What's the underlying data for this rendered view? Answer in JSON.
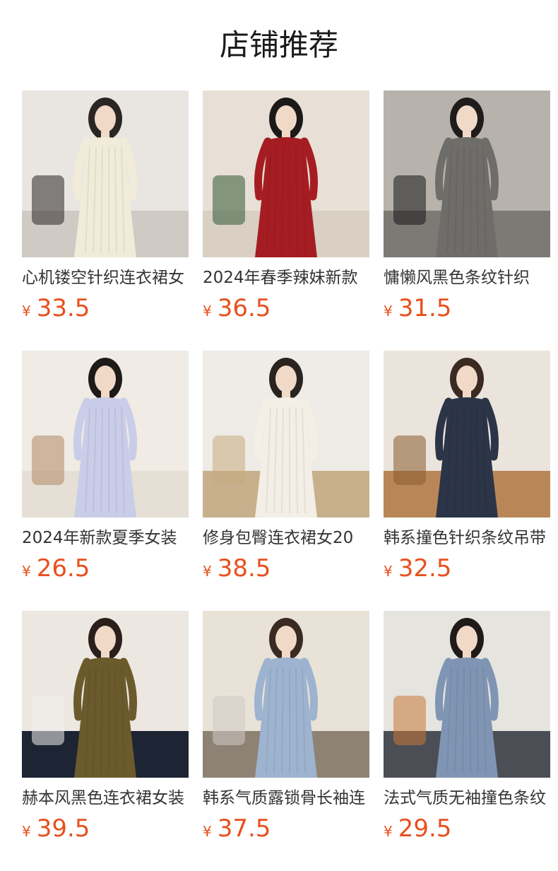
{
  "header": {
    "title": "店铺推荐"
  },
  "currency_symbol": "¥",
  "products": [
    {
      "title": "心机镂空针织连衣裙女",
      "price": "33.5",
      "image": "cream-ribbed-knit-cutout-dress-photo",
      "palette": {
        "bg": "#e9e6e1",
        "floor": "#cfcac3",
        "garment": "#f1ecd9",
        "hair": "#2a2623",
        "accent": "#2b2727"
      }
    },
    {
      "title": "2024年春季辣妹新款",
      "price": "36.5",
      "image": "red-knit-mini-dress-christmas-tree-photo",
      "palette": {
        "bg": "#e8e0d6",
        "floor": "#d9cfc3",
        "garment": "#a51d22",
        "hair": "#1c1919",
        "accent": "#2f5a34"
      }
    },
    {
      "title": "慵懒风黑色条纹针织",
      "price": "31.5",
      "image": "black-white-striped-slip-dress-street-photo",
      "palette": {
        "bg": "#b7b3ac",
        "floor": "#7d7a76",
        "garment": "#6f6d69",
        "hair": "#1f1c1b",
        "accent": "#151515"
      }
    },
    {
      "title": "2024年新款夏季女装",
      "price": "26.5",
      "image": "lavender-sleeveless-knit-dress-photo",
      "palette": {
        "bg": "#f0ebe4",
        "floor": "#e5dfd6",
        "garment": "#c9cde8",
        "hair": "#1e1a18",
        "accent": "#b08964"
      }
    },
    {
      "title": "修身包臀连衣裙女20",
      "price": "38.5",
      "image": "white-long-sleeve-knit-bodycon-dress-photo",
      "palette": {
        "bg": "#efebe6",
        "floor": "#c8b08c",
        "garment": "#f3eee6",
        "hair": "#2a2420",
        "accent": "#c7ab7f"
      }
    },
    {
      "title": "韩系撞色针织条纹吊带",
      "price": "32.5",
      "image": "navy-striped-knit-slip-dress-photo",
      "palette": {
        "bg": "#eae4dc",
        "floor": "#b98757",
        "garment": "#2c3447",
        "hair": "#3a2a22",
        "accent": "#8b5a2f"
      }
    },
    {
      "title": "赫本风黑色连衣裙女装",
      "price": "39.5",
      "image": "olive-cutout-knit-dress-mirror-photo",
      "palette": {
        "bg": "#ece7e0",
        "floor": "#1d2433",
        "garment": "#6b5a2c",
        "hair": "#2a1f1a",
        "accent": "#f3f1ee"
      }
    },
    {
      "title": "韩系气质露锁骨长袖连",
      "price": "37.5",
      "image": "blue-long-sleeve-knit-mini-dress-sofa-photo",
      "palette": {
        "bg": "#e9e2d7",
        "floor": "#8e8274",
        "garment": "#9db3cf",
        "hair": "#3a2b22",
        "accent": "#cfcbc6"
      }
    },
    {
      "title": "法式气质无袖撞色条纹",
      "price": "29.5",
      "image": "multicolor-striped-sleeveless-knit-dress-photo",
      "palette": {
        "bg": "#e6e4df",
        "floor": "#4b4e55",
        "garment": "#7f95b3",
        "hair": "#201b19",
        "accent": "#c8783a"
      }
    }
  ]
}
